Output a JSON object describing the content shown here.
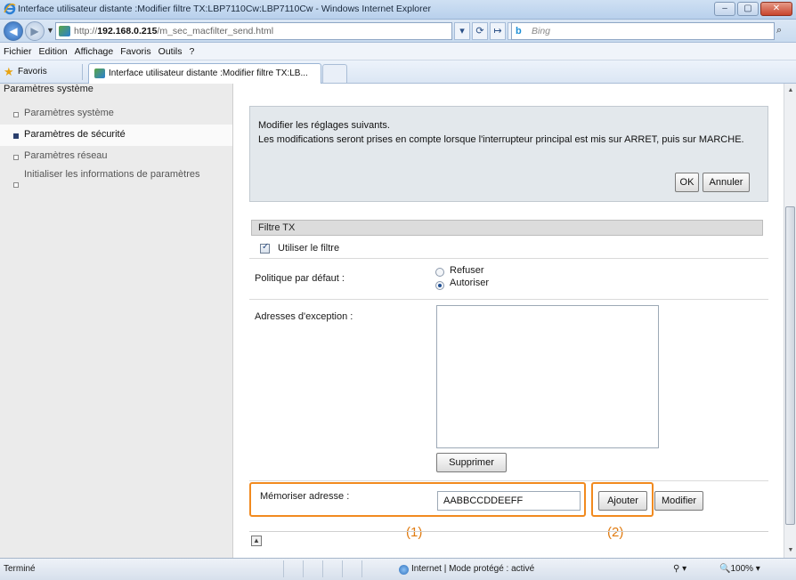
{
  "window": {
    "title": "Interface utilisateur distante :Modifier filtre TX:LBP7110Cw:LBP7110Cw - Windows Internet Explorer",
    "minimize_icon": "minimize-icon",
    "maximize_icon": "maximize-icon",
    "close_icon": "close-icon"
  },
  "address_bar": {
    "url_prefix": "http://",
    "url_host": "192.168.0.215",
    "url_path": "/m_sec_macfilter_send.html",
    "search_placeholder": "Bing"
  },
  "menu": [
    "Fichier",
    "Edition",
    "Affichage",
    "Favoris",
    "Outils",
    "?"
  ],
  "favorites_bar": {
    "favorites_label": "Favoris",
    "tab_label": "Interface utilisateur distante :Modifier filtre TX:LB..."
  },
  "sidebar": {
    "heading": "Paramètres système",
    "items": [
      {
        "label": "Paramètres système"
      },
      {
        "label": "Paramètres de sécurité"
      },
      {
        "label": "Paramètres réseau"
      },
      {
        "label": "Initialiser les informations de paramètres"
      }
    ]
  },
  "notice": {
    "line1": "Modifier les réglages suivants.",
    "line2": "Les modifications seront prises en compte lorsque l'interrupteur principal est mis sur ARRET, puis sur MARCHE.",
    "ok_label": "OK",
    "cancel_label": "Annuler"
  },
  "filter": {
    "section_title": "Filtre TX",
    "use_filter_label": "Utiliser le filtre",
    "use_filter_checked": true,
    "default_policy_label": "Politique par défaut :",
    "policy_options": [
      "Refuser",
      "Autoriser"
    ],
    "policy_selected": "Autoriser",
    "exception_label": "Adresses d'exception :",
    "exception_addresses": [],
    "delete_label": "Supprimer",
    "store_address_label": "Mémoriser adresse :",
    "store_address_value": "AABBCCDDEEFF",
    "add_label": "Ajouter",
    "modify_label": "Modifier"
  },
  "callouts": {
    "c1": "(1)",
    "c2": "(2)"
  },
  "status_bar": {
    "left": "Terminé",
    "zone": "Internet | Mode protégé : activé",
    "zoom": "100%"
  },
  "colors": {
    "highlight": "#f18a1f",
    "sidebar_bg": "#ebebeb",
    "notice_bg": "#e3e8ec"
  }
}
